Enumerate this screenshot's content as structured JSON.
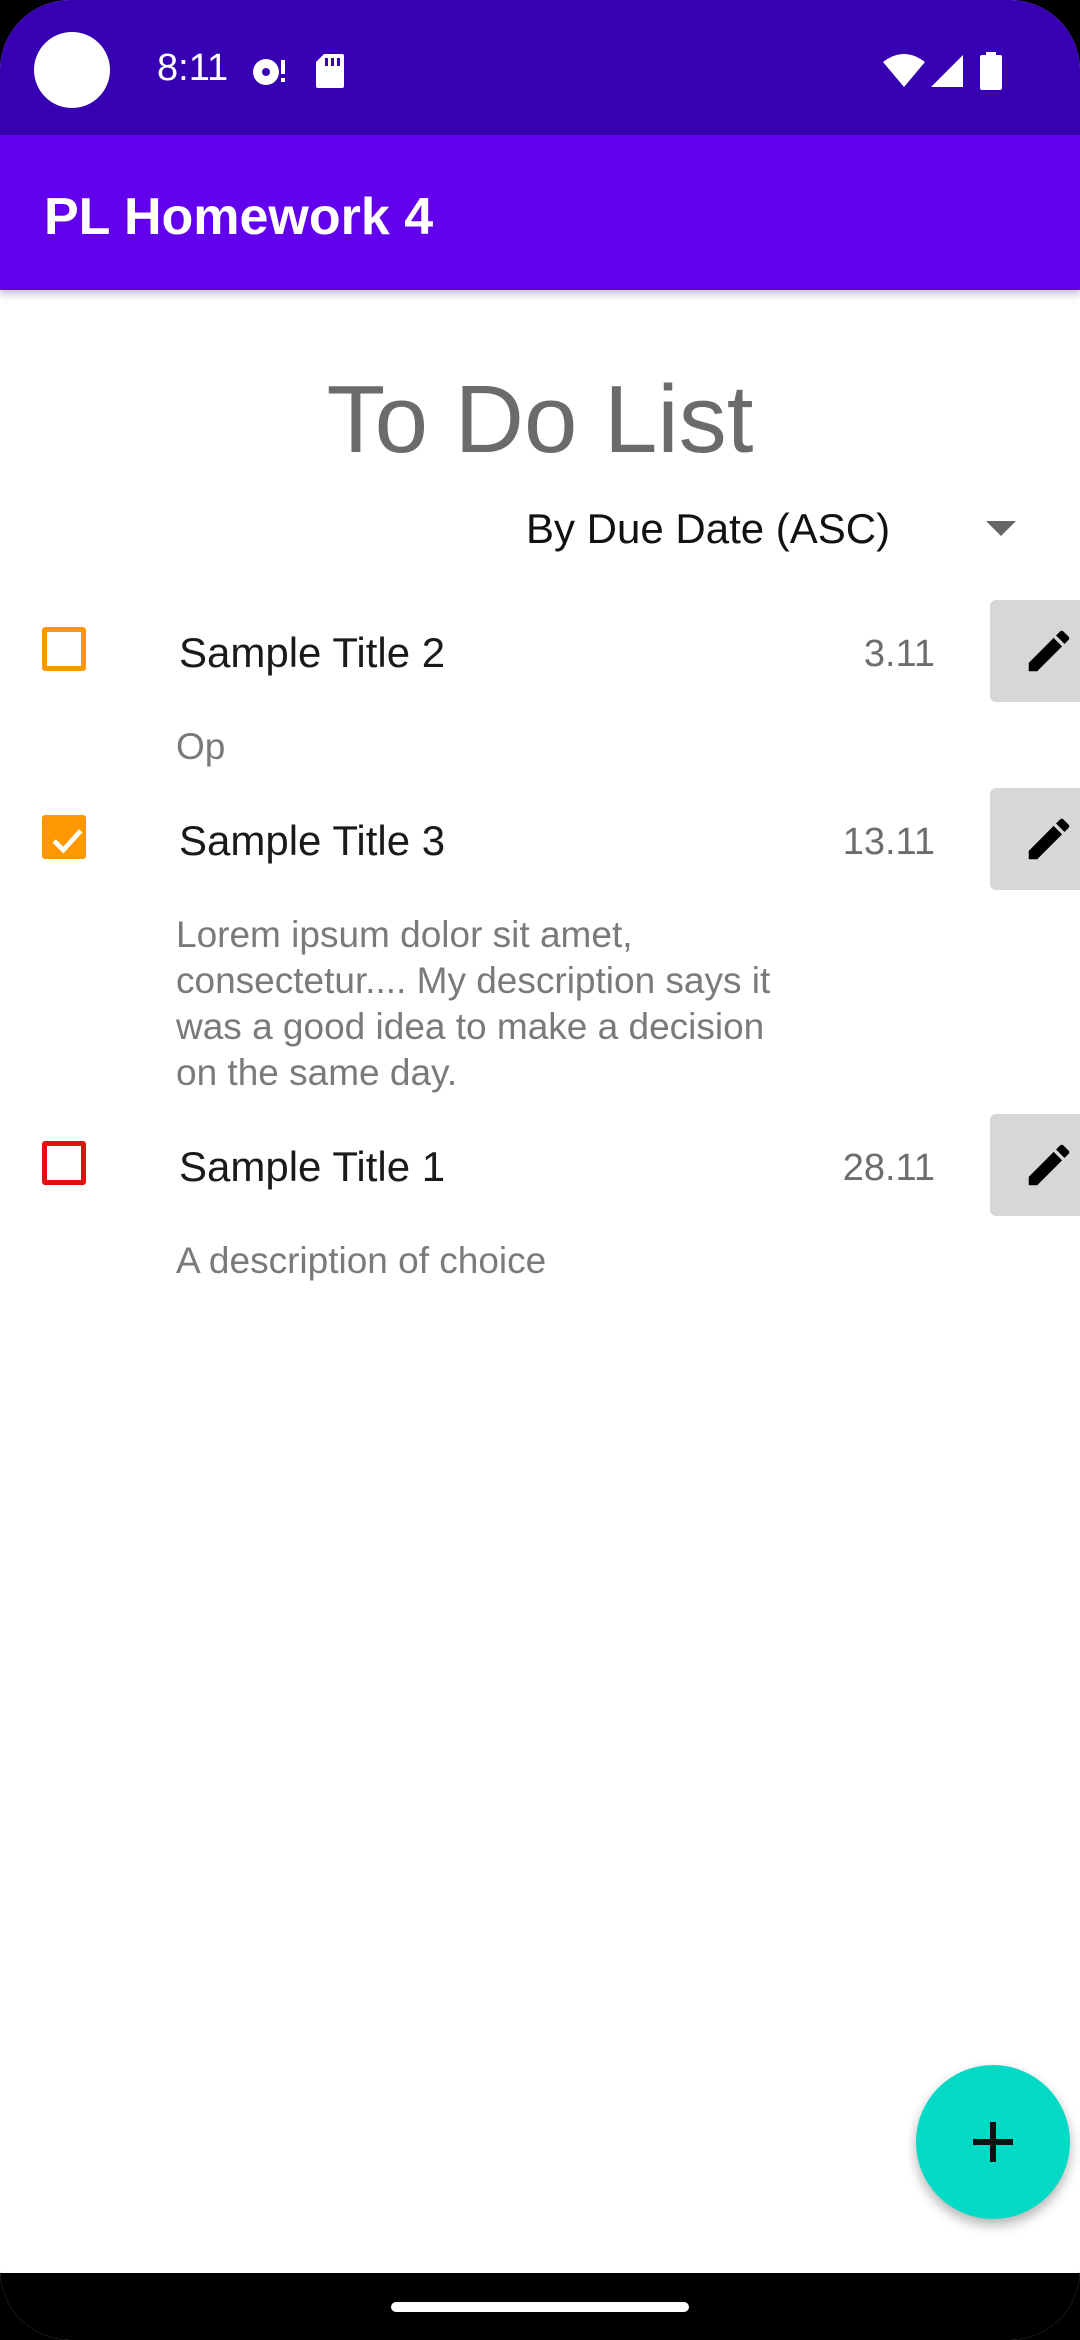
{
  "status_bar": {
    "time": "8:11",
    "icons": [
      "media-icon",
      "sd-card-icon",
      "wifi-icon",
      "signal-icon",
      "battery-icon"
    ]
  },
  "app_bar": {
    "title": "PL Homework 4"
  },
  "main": {
    "heading": "To Do List",
    "sort": {
      "selected": "By Due Date (ASC)"
    },
    "tasks": [
      {
        "title": "Sample Title 2",
        "date": "3.11",
        "description": "Op",
        "checked": false,
        "color": "#ff9800"
      },
      {
        "title": "Sample Title 3",
        "date": "13.11",
        "description": "Lorem ipsum dolor sit amet, consectetur.... My description says it was a good idea to make a decision on the same day.",
        "checked": true,
        "color": "#ff9800"
      },
      {
        "title": "Sample Title 1",
        "date": "28.11",
        "description": "A description of choice",
        "checked": false,
        "color": "#e01010"
      }
    ]
  },
  "colors": {
    "status_bar": "#3700b3",
    "app_bar": "#6200ee",
    "fab": "#03dac5",
    "edit_button": "#d7d7d7"
  },
  "fab": {
    "icon": "plus-icon"
  }
}
